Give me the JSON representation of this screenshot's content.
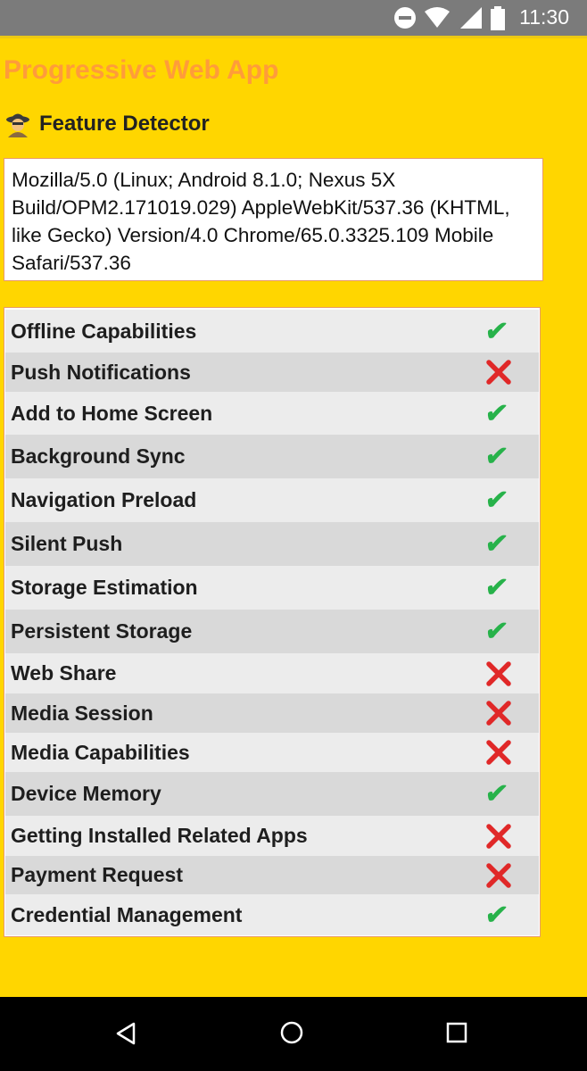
{
  "status_bar": {
    "time": "11:30"
  },
  "header": {
    "title": "Progressive Web App",
    "subtitle": "Feature Detector"
  },
  "user_agent": "Mozilla/5.0 (Linux; Android 8.1.0; Nexus 5X Build/OPM2.171019.029) AppleWebKit/537.36 (KHTML, like Gecko) Version/4.0 Chrome/65.0.3325.109 Mobile Safari/537.36",
  "features": [
    {
      "label": "Offline Capabilities",
      "supported": true
    },
    {
      "label": "Push Notifications",
      "supported": false
    },
    {
      "label": "Add to Home Screen",
      "supported": true
    },
    {
      "label": "Background Sync",
      "supported": true
    },
    {
      "label": "Navigation Preload",
      "supported": true
    },
    {
      "label": "Silent Push",
      "supported": true
    },
    {
      "label": "Storage Estimation",
      "supported": true
    },
    {
      "label": "Persistent Storage",
      "supported": true
    },
    {
      "label": "Web Share",
      "supported": false
    },
    {
      "label": "Media Session",
      "supported": false
    },
    {
      "label": "Media Capabilities",
      "supported": false
    },
    {
      "label": "Device Memory",
      "supported": true
    },
    {
      "label": "Getting Installed Related Apps",
      "supported": false
    },
    {
      "label": "Payment Request",
      "supported": false
    },
    {
      "label": "Credential Management",
      "supported": true
    }
  ],
  "colors": {
    "background": "#FFD600",
    "title": "#ff9c3a",
    "check": "#27b24a",
    "cross": "#e02828"
  }
}
